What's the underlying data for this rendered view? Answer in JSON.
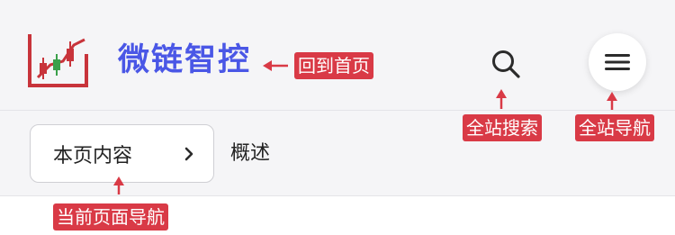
{
  "header": {
    "site_name": "微链智控",
    "search_icon": "search-icon",
    "menu_icon": "hamburger-menu-icon"
  },
  "subnav": {
    "toc_label": "本页内容",
    "toc_icon": "chevron-right-icon",
    "section_title": "概述"
  },
  "annotations": {
    "home": "回到首页",
    "search": "全站搜索",
    "site_nav": "全站导航",
    "page_nav": "当前页面导航"
  },
  "colors": {
    "brand": "#4a57e6",
    "annotation": "#d93a46",
    "logo": "#c8343b",
    "logo_accent": "#3aa04a",
    "background": "#f5f5f7"
  }
}
